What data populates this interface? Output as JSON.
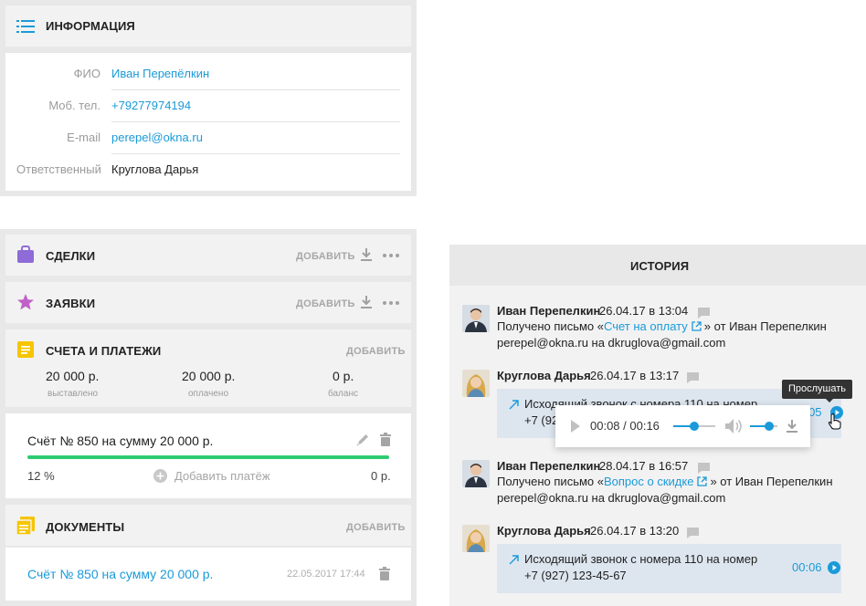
{
  "info": {
    "title": "ИНФОРМАЦИЯ",
    "fields": [
      {
        "label": "ФИО",
        "value": "Иван Перепёлкин"
      },
      {
        "label": "Моб. тел.",
        "value": "+79277974194"
      },
      {
        "label": "E-mail",
        "value": "perepel@okna.ru"
      },
      {
        "label": "Ответственный",
        "value": "Круглова Дарья"
      }
    ]
  },
  "deals": {
    "title": "СДЕЛКИ",
    "add": "ДОБАВИТЬ"
  },
  "requests": {
    "title": "ЗАЯВКИ",
    "add": "ДОБАВИТЬ"
  },
  "payments": {
    "title": "СЧЕТА И ПЛАТЕЖИ",
    "add": "ДОБАВИТЬ",
    "stats": [
      {
        "value": "20 000 р.",
        "label": "выставлено"
      },
      {
        "value": "20 000 р.",
        "label": "оплачено"
      },
      {
        "value": "0 р.",
        "label": "баланс"
      }
    ]
  },
  "invoice": {
    "title": "Счёт № 850 на сумму 20 000 р.",
    "progress_percent": "12 %",
    "progress_fill": 1.0,
    "add_payment": "Добавить платёж",
    "balance": "0 р."
  },
  "documents": {
    "title": "ДОКУМЕНТЫ",
    "add": "ДОБАВИТЬ",
    "item_title": "Счёт № 850 на сумму 20 000 р.",
    "item_date": "22.05.2017 17:44"
  },
  "history": {
    "title": "ИСТОРИЯ",
    "entries": [
      {
        "name": "Иван Перепелкин",
        "date": "26.04.17 в 13:04",
        "pre": "Получено письмо «",
        "link": "Счет на оплату",
        "post": "» ",
        "tail": "от Иван Перепелкин",
        "line2": "perepel@okna.ru на dkruglova@gmail.com"
      },
      {
        "name": "Круглова Дарья",
        "date": "26.04.17 в 13:17",
        "call1": "Исходящий звонок с номера 110 на номер",
        "call2": "+7 (927",
        "duration": "00:05"
      },
      {
        "name": "Иван Перепелкин",
        "date": "28.04.17 в 16:57",
        "pre": "Получено письмо «",
        "link": "Вопрос о скидке",
        "post": "» ",
        "tail": "от Иван Перепелкин",
        "line2": "perepel@okna.ru на dkruglova@gmail.com"
      },
      {
        "name": "Круглова Дарья",
        "date": "26.04.17 в 13:20",
        "call1": "Исходящий звонок с номера 110 на номер",
        "call2": "+7 (927) 123-45-67",
        "duration": "00:06"
      }
    ],
    "player": {
      "time": "00:08 / 00:16",
      "progress": 0.5,
      "volume": 0.7
    },
    "tooltip": "Прослушать"
  },
  "colors": {
    "accent": "#1a9ad9",
    "progress": "#2ecc71",
    "deals_icon": "#8e6bd6",
    "requests_icon": "#c061c8",
    "payments_icon": "#f6c500"
  }
}
